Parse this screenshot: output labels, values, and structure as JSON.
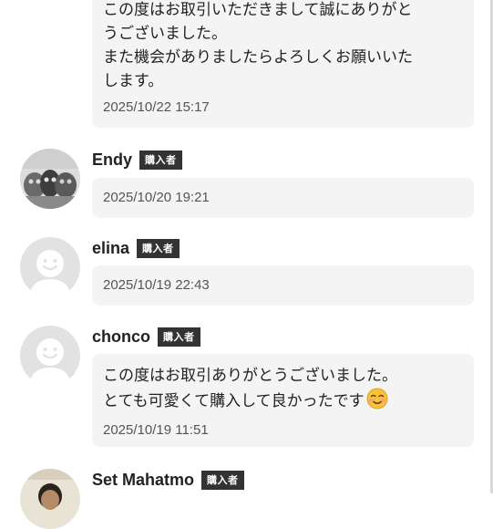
{
  "reviews": [
    {
      "name": "",
      "badge": "",
      "message": "この度はお取引いただきまして誠にありがと\nうございました。\nまた機会がありましたらよろしくお願いいた\nします。",
      "date": "2025/10/22 15:17",
      "avatar": "none"
    },
    {
      "name": "Endy",
      "badge": "購入者",
      "message": "",
      "date": "2025/10/20 19:21",
      "avatar": "photo-avatar"
    },
    {
      "name": "elina",
      "badge": "購入者",
      "message": "",
      "date": "2025/10/19 22:43",
      "avatar": "default-avatar"
    },
    {
      "name": "chonco",
      "badge": "購入者",
      "message": "この度はお取引ありがとうございました。\nとても可愛くて購入して良かったです",
      "emoji": "smiling-face-emoji",
      "date": "2025/10/19 11:51",
      "avatar": "default-avatar"
    },
    {
      "name": "Set Mahatmo",
      "badge": "購入者",
      "message": "",
      "date": "",
      "avatar": "photo-avatar"
    }
  ],
  "colors": {
    "bubble": "#f4f4f4",
    "badge_bg": "#333333",
    "badge_text": "#ffffff",
    "text": "#222222",
    "timestamp": "#555555",
    "default_avatar_bg": "#e2e2e2",
    "default_avatar_face": "#ffffff"
  }
}
